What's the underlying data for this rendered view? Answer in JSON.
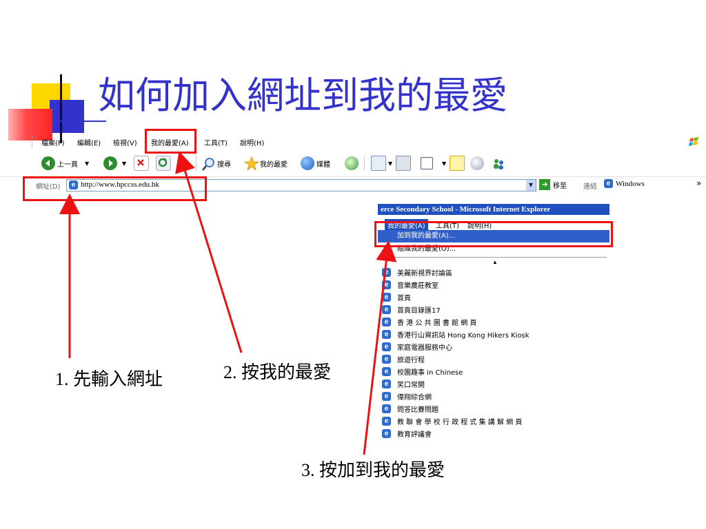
{
  "slide": {
    "title": "如何加入網址到我的最愛"
  },
  "browser": {
    "menu": [
      "檔案(F)",
      "編輯(E)",
      "檢視(V)",
      "我的最愛(A)",
      "工具(T)",
      "說明(H)"
    ],
    "toolbar": {
      "back": "上一頁",
      "search": "搜尋",
      "favorites": "我的最愛",
      "media": "媒體"
    },
    "address": {
      "label": "網址(D)",
      "url": "http://www.hpccss.edu.hk",
      "go": "移至",
      "links": "連結",
      "windows": "Windows",
      "more": "»"
    }
  },
  "popup": {
    "title": "erce Secondary School - Microsoft Internet Explorer",
    "menu": [
      "我的最愛(A)",
      "工具(T)",
      "說明(H)"
    ],
    "add_favorite": "加到我的最愛(A)...",
    "organize": "組織我的最愛(O)...",
    "favorites": [
      "美麗新視界討論區",
      "音樂農莊教室",
      "首頁",
      "首頁目錄匯17",
      "香 港 公 共 圖 書 館 網 頁",
      "香港行山資訊站 Hong Kong Hikers Kiosk",
      "家庭電器服務中心",
      "旅遊行程",
      "校園趣事 in Chinese",
      "笑口常開",
      "偉翔綜合網",
      "問答比賽問題",
      "教 聯 會 學 校 行 政 程 式 集 講 解 網 頁",
      "教育評議會"
    ]
  },
  "captions": {
    "step1": "1. 先輸入網址",
    "step2": "2. 按我的最愛",
    "step3": "3. 按加到我的最愛"
  },
  "colors": {
    "title": "#3333cc",
    "highlight": "#e11111",
    "ie_blue": "#2050c0"
  }
}
